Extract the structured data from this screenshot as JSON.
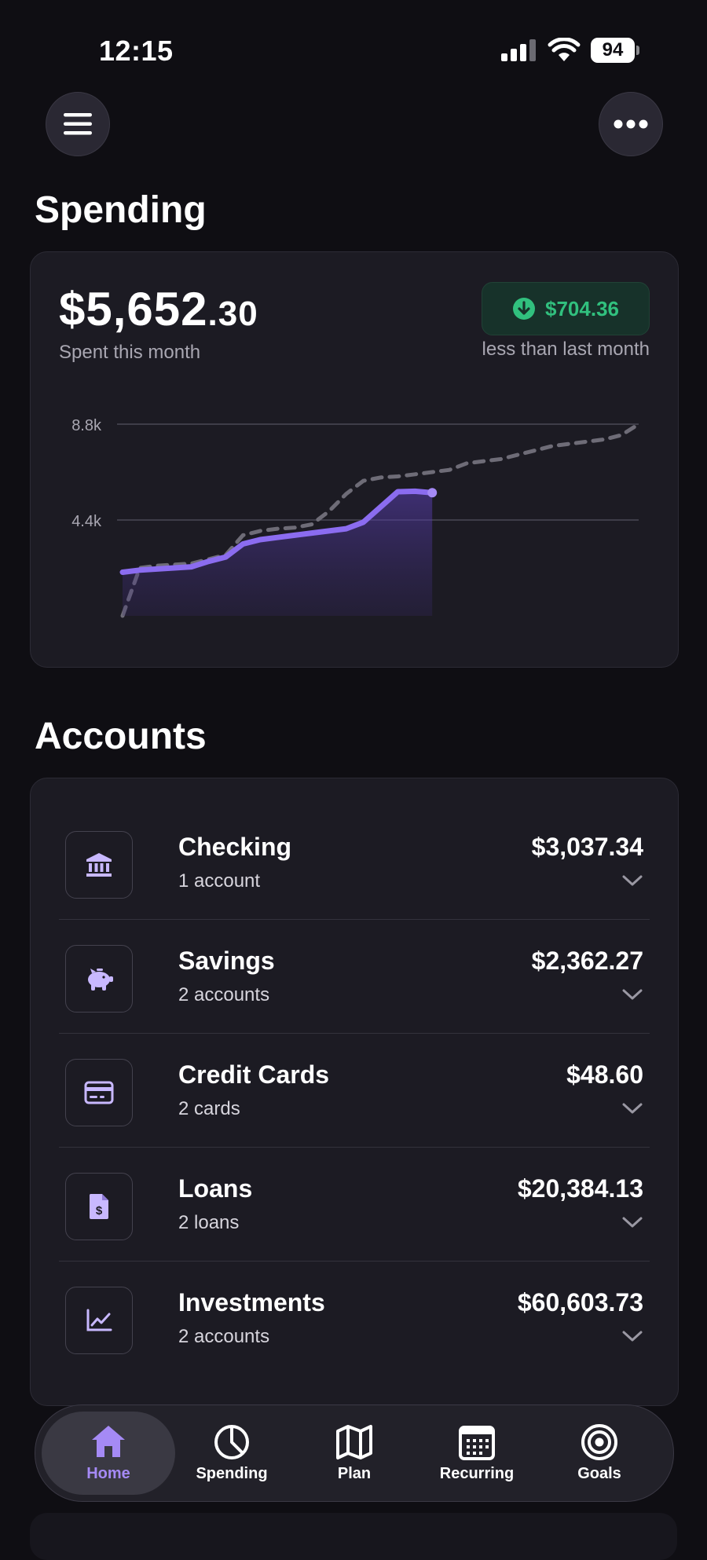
{
  "status_bar": {
    "time": "12:15",
    "battery": "94"
  },
  "spending": {
    "section_title": "Spending",
    "amount_whole": "$5,652",
    "amount_cents": ".30",
    "amount_label": "Spent this month",
    "delta_amount": "$704.36",
    "delta_label": "less than last month",
    "colors": {
      "accent": "#8b6cf0",
      "positive": "#31c07e"
    }
  },
  "chart_data": {
    "type": "line",
    "y_ticks": [
      "8.8k",
      "4.4k"
    ],
    "ylim": [
      0,
      8800
    ],
    "grid": true,
    "series": [
      {
        "style": "solid-area",
        "x": [
          1,
          2,
          3,
          4,
          5,
          6,
          7,
          8,
          9,
          10,
          11,
          12,
          13,
          14,
          15,
          16,
          17,
          18,
          19
        ],
        "values": [
          2000,
          2100,
          2150,
          2200,
          2250,
          2500,
          2700,
          3300,
          3500,
          3600,
          3700,
          3800,
          3900,
          4000,
          4300,
          5000,
          5700,
          5720,
          5652
        ]
      },
      {
        "style": "dashed",
        "x": [
          1,
          2,
          3,
          4,
          5,
          6,
          7,
          8,
          9,
          10,
          11,
          12,
          13,
          14,
          15,
          16,
          17,
          18,
          19,
          20,
          21,
          22,
          23,
          24,
          25,
          26,
          27,
          28,
          29,
          30,
          31
        ],
        "values": [
          0,
          2200,
          2300,
          2350,
          2400,
          2600,
          2800,
          3700,
          3900,
          4000,
          4050,
          4200,
          4800,
          5600,
          6200,
          6350,
          6400,
          6500,
          6600,
          6700,
          7000,
          7100,
          7200,
          7400,
          7600,
          7800,
          7900,
          8000,
          8100,
          8300,
          8800
        ]
      }
    ]
  },
  "accounts": {
    "section_title": "Accounts",
    "items": [
      {
        "name": "Checking",
        "sub": "1 account",
        "amount": "$3,037.34",
        "icon": "bank-icon"
      },
      {
        "name": "Savings",
        "sub": "2 accounts",
        "amount": "$2,362.27",
        "icon": "piggy-bank-icon"
      },
      {
        "name": "Credit Cards",
        "sub": "2 cards",
        "amount": "$48.60",
        "icon": "credit-card-icon"
      },
      {
        "name": "Loans",
        "sub": "2 loans",
        "amount": "$20,384.13",
        "icon": "loan-document-icon"
      },
      {
        "name": "Investments",
        "sub": "2 accounts",
        "amount": "$60,603.73",
        "icon": "line-chart-icon"
      }
    ]
  },
  "nav": {
    "items": [
      {
        "label": "Home",
        "icon": "home-icon",
        "active": true
      },
      {
        "label": "Spending",
        "icon": "pie-chart-icon"
      },
      {
        "label": "Plan",
        "icon": "map-icon"
      },
      {
        "label": "Recurring",
        "icon": "calendar-icon"
      },
      {
        "label": "Goals",
        "icon": "target-icon"
      }
    ]
  }
}
